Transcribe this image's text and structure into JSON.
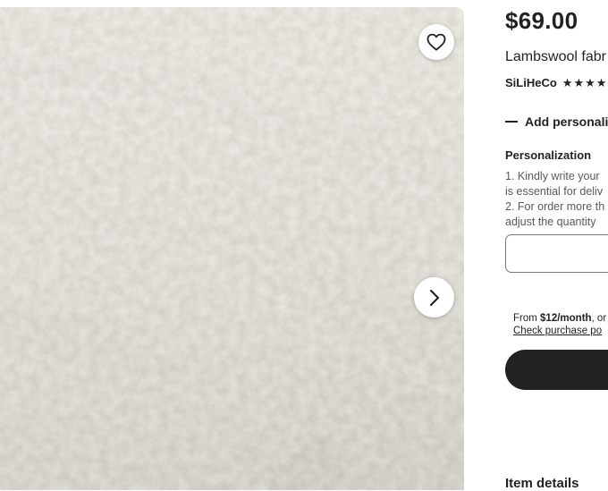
{
  "listing": {
    "price": "$69.00",
    "title": "Lambswool fabr",
    "shop_name": "SiLiHeCo",
    "rating_icons": [
      "star-icon",
      "star-icon",
      "star-icon",
      "star-icon"
    ],
    "add_personalisation_label": "Add personalisa",
    "personalization": {
      "heading": "Personalization",
      "lines": [
        "1. Kindly write your",
        "is essential for deliv",
        "2. For order more th",
        "adjust the quantity"
      ],
      "input_value": ""
    },
    "financing": {
      "prefix": "From ",
      "amount": "$12/month",
      "suffix": ", or",
      "link_text": "Check purchase po"
    },
    "add_to_cart_label": "",
    "item_details_heading": "Item details"
  },
  "image_panel": {
    "favorite_icon": "heart-icon",
    "next_icon": "chevron-right-icon",
    "image_subject": "lambswool-fabric-photo"
  },
  "colors": {
    "text": "#222222",
    "muted": "#595959",
    "button_dark": "#222222",
    "fabric_base": "#d8d5cf"
  }
}
